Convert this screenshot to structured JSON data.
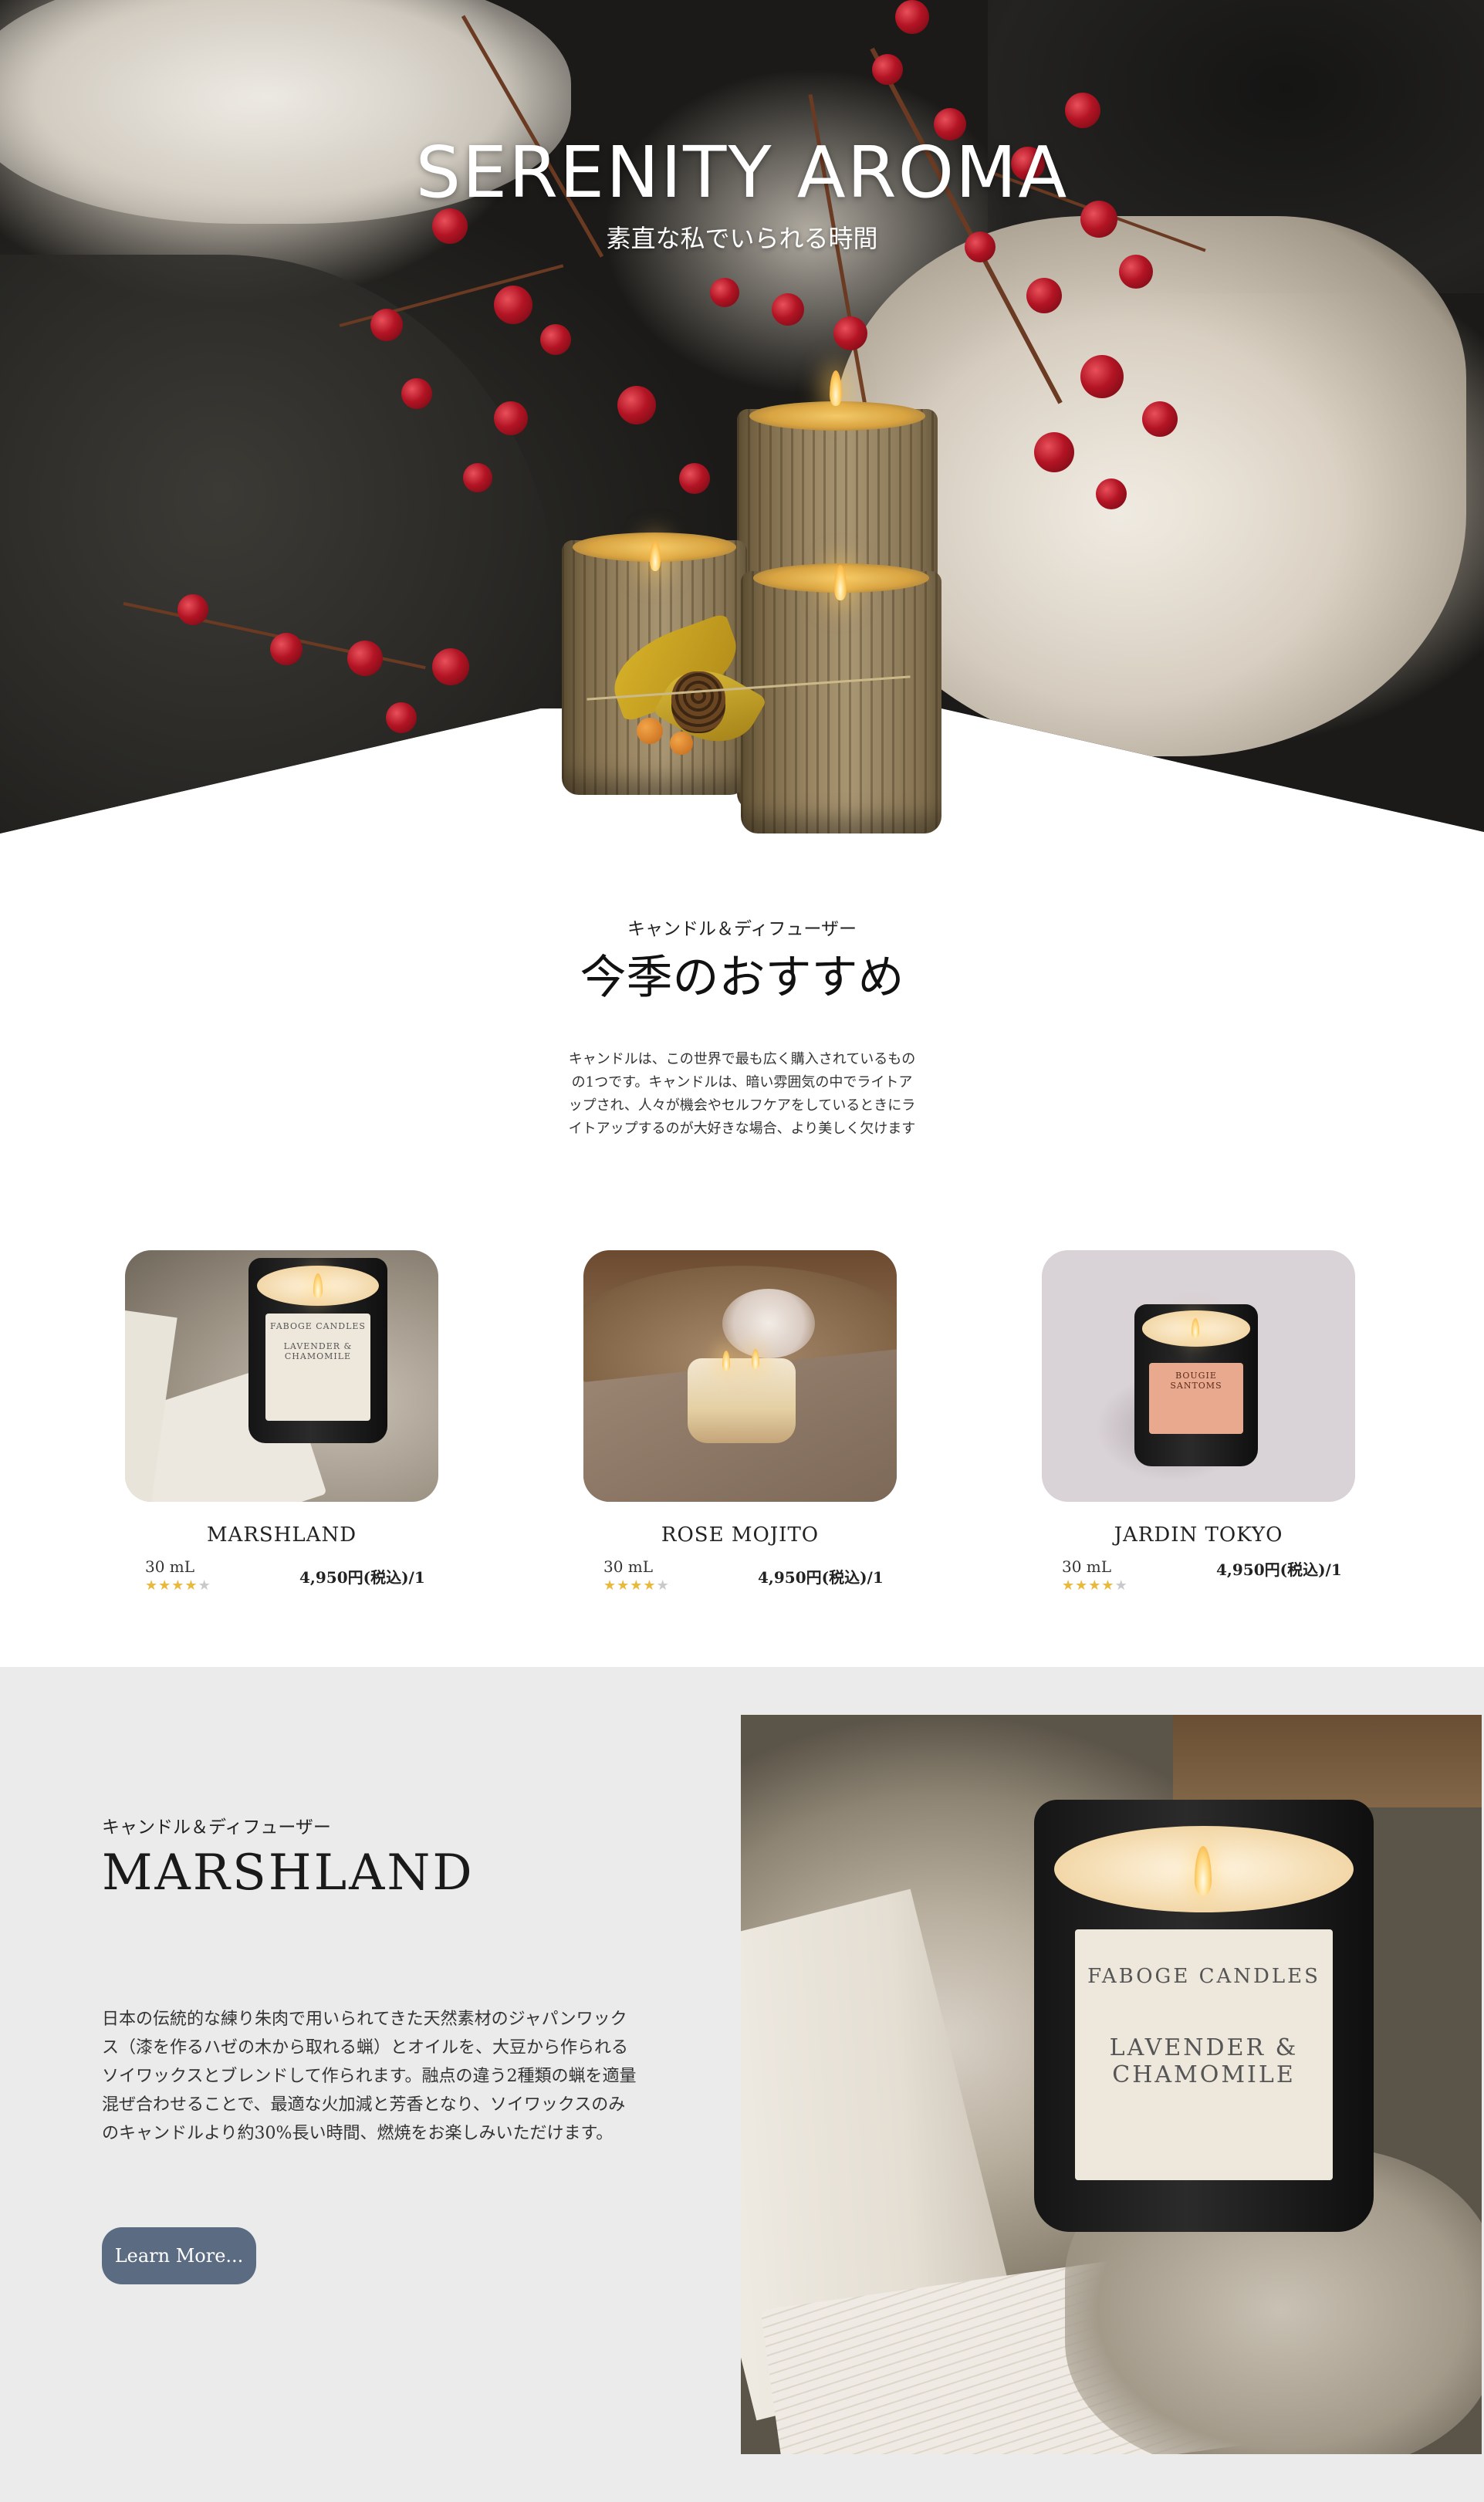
{
  "hero": {
    "title": "SERENITY AROMA",
    "subtitle": "素直な私でいられる時間"
  },
  "recommend": {
    "kicker": "キャンドル＆ディフューザー",
    "title": "今季のおすすめ",
    "description": "キャンドルは、この世界で最も広く購入されているものの1つです。キャンドルは、暗い雰囲気の中でライトアップされ、人々が機会やセルフケアをしているときにライトアップするのが大好きな場合、より美しく欠けます"
  },
  "products": [
    {
      "name": "MARSHLAND",
      "volume": "30 mL",
      "price": "4,950円(税込)/1",
      "rating": 4,
      "rating_max": 5,
      "label_brand": "FABOGE CANDLES",
      "label_scent": "LAVENDER & CHAMOMILE"
    },
    {
      "name": "ROSE MOJITO",
      "volume": "30 mL",
      "price": "4,950円(税込)/1",
      "rating": 4,
      "rating_max": 5
    },
    {
      "name": "JARDIN TOKYO",
      "volume": "30 mL",
      "price": "4,950円(税込)/1",
      "rating": 4,
      "rating_max": 5,
      "label_brand": "BOUGIE SANTOMS"
    }
  ],
  "feature": {
    "kicker": "キャンドル＆ディフューザー",
    "title": "MARSHLAND",
    "description": "日本の伝統的な練り朱肉で用いられてきた天然素材のジャパンワックス（漆を作るハゼの木から取れる蝋）とオイルを、大豆から作られるソイワックスとブレンドして作られます。融点の違う2種類の蝋を適量混ぜ合わせることで、最適な火加減と芳香となり、ソイワックスのみのキャンドルより約30%長い時間、燃焼をお楽しみいただけます。",
    "button_label": "Learn More...",
    "label_brand": "FABOGE CANDLES",
    "label_scent": "LAVENDER & CHAMOMILE"
  },
  "colors": {
    "button": "#5b6b82",
    "star_on": "#e8b93c",
    "star_off": "#c9c9c9",
    "feature_bg": "#ebebeb"
  }
}
